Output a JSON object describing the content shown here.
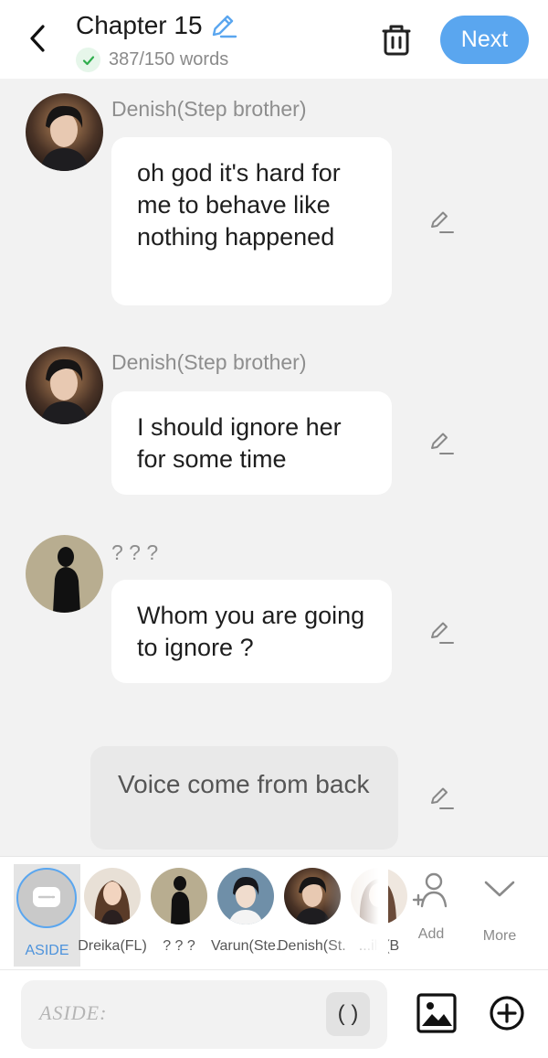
{
  "header": {
    "title": "Chapter 15",
    "word_count": "387/150 words",
    "next_label": "Next"
  },
  "messages": [
    {
      "speaker": "Denish(Step brother)",
      "text": "oh god it's hard for me to behave like nothing happened"
    },
    {
      "speaker": "Denish(Step brother)",
      "text": "I should ignore her for some time"
    },
    {
      "speaker": "? ? ?",
      "text": "Whom you are going to ignore ?"
    }
  ],
  "aside_message": {
    "text": "Voice come from back"
  },
  "character_bar": {
    "aside_label": "ASIDE",
    "characters": [
      {
        "label": "Dreika(FL)"
      },
      {
        "label": "? ? ?"
      },
      {
        "label": "Varun(Ste..."
      },
      {
        "label": "Denish(St..."
      },
      {
        "label": "...ily(B"
      }
    ],
    "add_label": "Add",
    "more_label": "More"
  },
  "input": {
    "placeholder": "ASIDE:",
    "paren_label": "( )"
  },
  "colors": {
    "accent": "#5aa6ef",
    "check_green": "#2fae4d",
    "background": "#f2f2f2"
  },
  "icons": [
    "back-arrow-icon",
    "pencil-icon",
    "check-icon",
    "trash-icon",
    "aside-icon",
    "add-person-icon",
    "chevron-down-icon",
    "image-icon",
    "plus-circle-icon"
  ]
}
